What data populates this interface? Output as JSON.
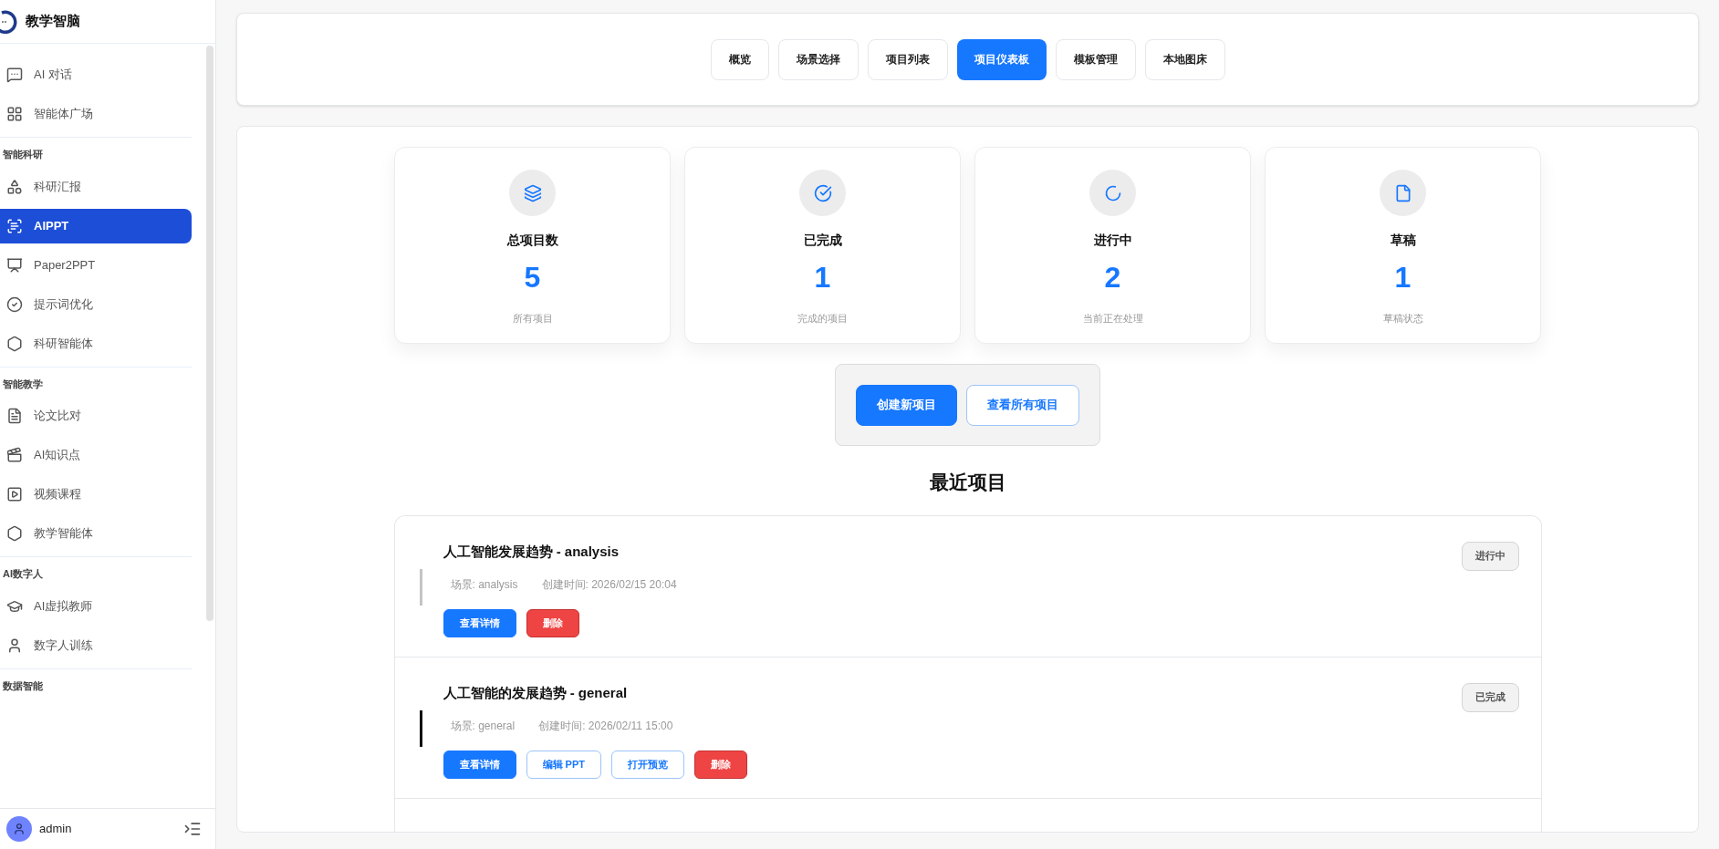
{
  "brand": {
    "name": "教学智脑"
  },
  "sidebar": {
    "sections": [
      {
        "items": [
          {
            "label": "AI 对话",
            "selected": false
          },
          {
            "label": "智能体广场",
            "selected": false
          }
        ]
      },
      {
        "heading": "智能科研",
        "items": [
          {
            "label": "科研汇报",
            "selected": false
          },
          {
            "label": "AIPPT",
            "selected": true
          },
          {
            "label": "Paper2PPT",
            "selected": false
          },
          {
            "label": "提示词优化",
            "selected": false
          },
          {
            "label": "科研智能体",
            "selected": false
          }
        ]
      },
      {
        "heading": "智能教学",
        "items": [
          {
            "label": "论文比对",
            "selected": false
          },
          {
            "label": "AI知识点",
            "selected": false
          },
          {
            "label": "视频课程",
            "selected": false
          },
          {
            "label": "教学智能体",
            "selected": false
          }
        ]
      },
      {
        "heading": "AI数字人",
        "items": [
          {
            "label": "AI虚拟教师",
            "selected": false
          },
          {
            "label": "数字人训练",
            "selected": false
          }
        ]
      },
      {
        "heading": "数据智能"
      }
    ],
    "user": "admin"
  },
  "tabs": [
    {
      "label": "概览",
      "selected": false
    },
    {
      "label": "场景选择",
      "selected": false
    },
    {
      "label": "项目列表",
      "selected": false
    },
    {
      "label": "项目仪表板",
      "selected": true
    },
    {
      "label": "模板管理",
      "selected": false
    },
    {
      "label": "本地图床",
      "selected": false
    }
  ],
  "stats": [
    {
      "title": "总项目数",
      "value": "5",
      "caption": "所有项目"
    },
    {
      "title": "已完成",
      "value": "1",
      "caption": "完成的项目"
    },
    {
      "title": "进行中",
      "value": "2",
      "caption": "当前正在处理"
    },
    {
      "title": "草稿",
      "value": "1",
      "caption": "草稿状态"
    }
  ],
  "actions": [
    {
      "label": "创建新项目",
      "kind": "primary"
    },
    {
      "label": "查看所有项目",
      "kind": "outline"
    }
  ],
  "recent": {
    "title": "最近项目",
    "projects": [
      {
        "title": "人工智能发展趋势 - analysis",
        "scene": "场景: analysis",
        "created": "创建时间: 2026/02/15 20:04",
        "status": "进行中",
        "color": "#c4c4c4",
        "buttons": [
          {
            "label": "查看详情",
            "kind": "primary"
          },
          {
            "label": "删除",
            "kind": "danger"
          }
        ]
      },
      {
        "title": "人工智能的发展趋势 - general",
        "scene": "场景: general",
        "created": "创建时间: 2026/02/11 15:00",
        "status": "已完成",
        "color": "#111111",
        "buttons": [
          {
            "label": "查看详情",
            "kind": "primary"
          },
          {
            "label": "编辑 PPT",
            "kind": "outline"
          },
          {
            "label": "打开预览",
            "kind": "outline"
          },
          {
            "label": "删除",
            "kind": "danger"
          }
        ]
      }
    ]
  }
}
